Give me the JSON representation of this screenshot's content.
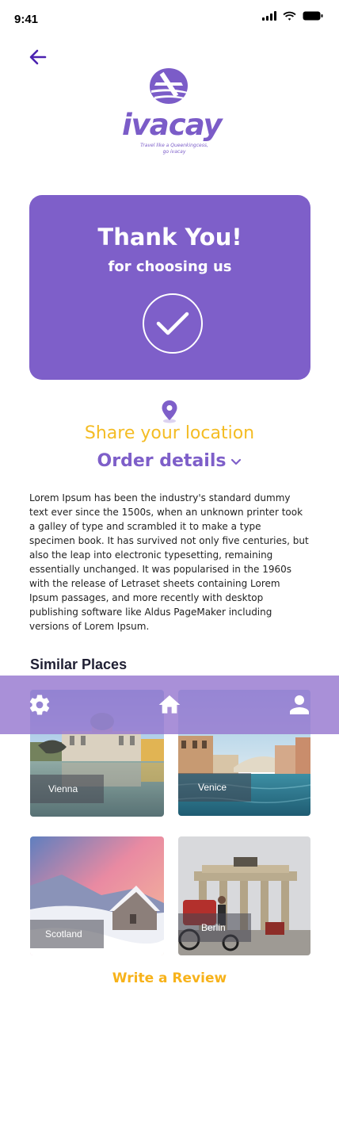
{
  "status_bar": {
    "time": "9:41"
  },
  "logo": {
    "word": "ivacay",
    "tagline": "Travel like a Queenkingcess,\ngo ivacay"
  },
  "thanks_card": {
    "title": "Thank You!",
    "subtitle": "for choosing us"
  },
  "share_location": {
    "label": "Share your location"
  },
  "order_details": {
    "label": "Order details"
  },
  "description": "Lorem Ipsum has been the industry's standard dummy text ever since the 1500s, when an unknown printer took a galley of type and scrambled it to make a type specimen book. It has survived not only five centuries, but also the leap into electronic typesetting, remaining essentially unchanged. It was popularised in the 1960s with the release of Letraset sheets containing Lorem Ipsum passages, and more recently with desktop publishing software like Aldus PageMaker including versions of Lorem Ipsum.",
  "similar_places": {
    "title": "Similar Places",
    "items": [
      {
        "name": "Vienna"
      },
      {
        "name": "Venice"
      },
      {
        "name": "Scotland"
      },
      {
        "name": "Berlin"
      }
    ]
  },
  "review": {
    "label": "Write a Review"
  },
  "colors": {
    "brand_purple": "#7e5fc9",
    "accent_yellow": "#f4bc24",
    "nav_bar": "#9678d0"
  },
  "icons": {
    "back": "arrow-left-icon",
    "pin": "location-pin-icon",
    "check": "checkmark-icon",
    "settings": "gear-icon",
    "home": "home-icon",
    "profile": "user-icon"
  }
}
